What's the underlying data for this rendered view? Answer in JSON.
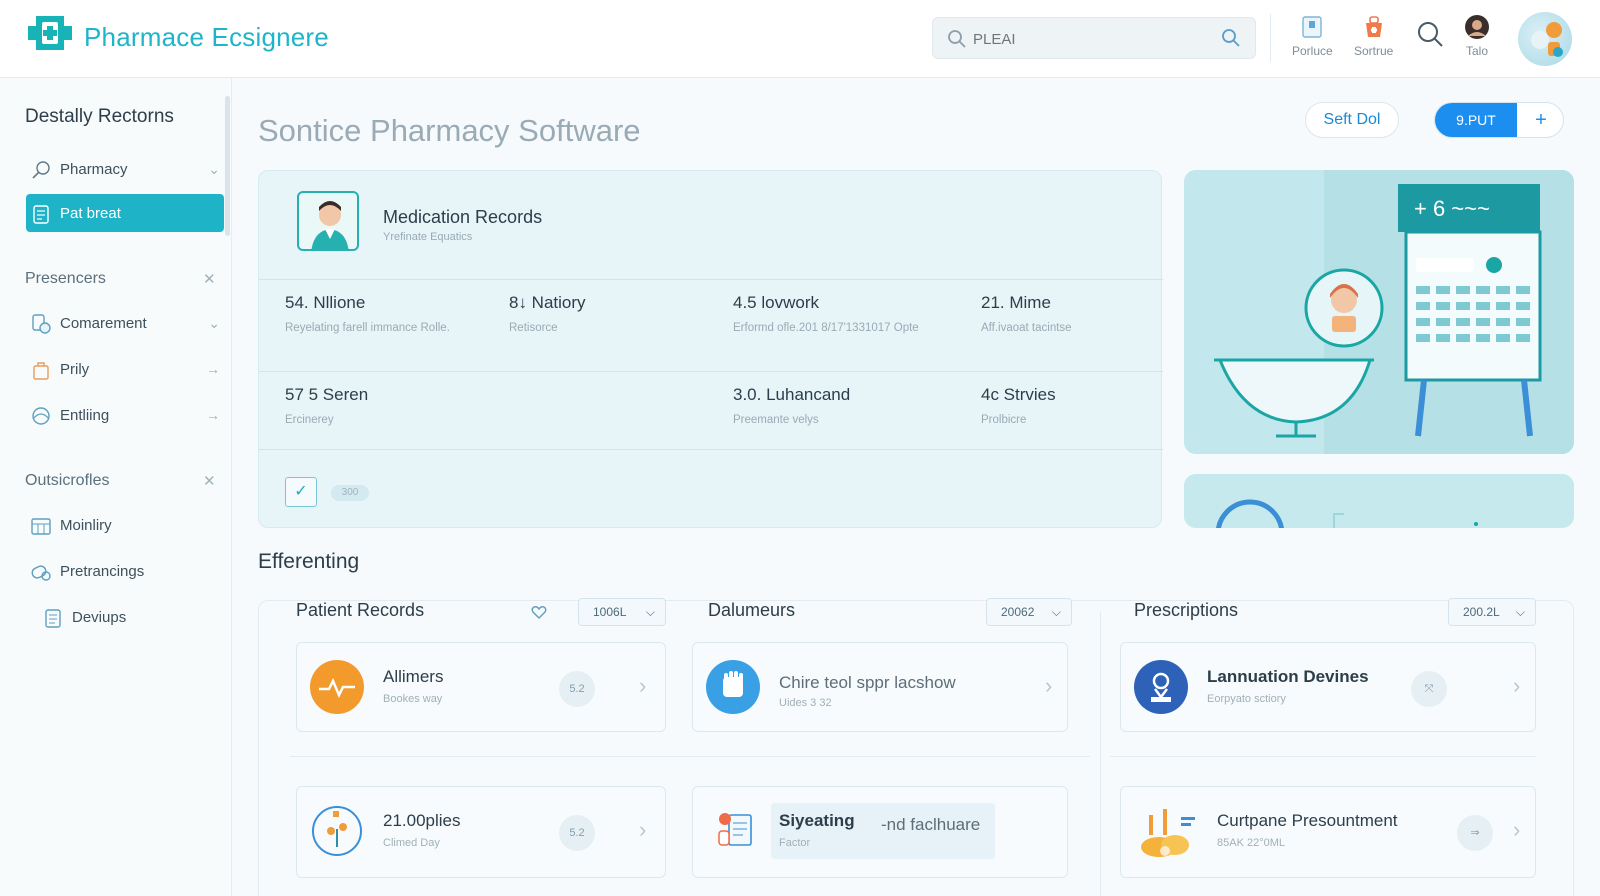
{
  "header": {
    "app_title": "Pharmace Ecsignere",
    "search_placeholder": "PLEAI",
    "buttons": [
      {
        "label": "Porluce",
        "icon": "clipboard-icon"
      },
      {
        "label": "Sortrue",
        "icon": "medicine-bag-icon"
      },
      {
        "label": "",
        "icon": "search-icon"
      },
      {
        "label": "Talo",
        "icon": "user-avatar-icon"
      }
    ]
  },
  "sidebar": {
    "title": "Destally Rectorns",
    "items_top": [
      {
        "label": "Pharmacy",
        "icon": "search-pill-icon"
      },
      {
        "label": "Pat breat",
        "icon": "document-icon",
        "active": true
      }
    ],
    "section1": {
      "heading": "Presencers",
      "items": [
        {
          "label": "Comarement",
          "icon": "pill-shield-icon"
        },
        {
          "label": "Prily",
          "icon": "bag-icon"
        },
        {
          "label": "Entliing",
          "icon": "medical-cross-icon"
        }
      ]
    },
    "section2": {
      "heading": "Outsicrofles",
      "items": [
        {
          "label": "Moinliry",
          "icon": "calendar-grid-icon"
        },
        {
          "label": "Pretrancings",
          "icon": "pills-icon"
        },
        {
          "label": "Deviups",
          "icon": "notes-icon"
        }
      ]
    }
  },
  "main": {
    "page_title": "Sontice Pharmacy Software",
    "self_button": "Seft Dol",
    "split_button_label": "9.PUT",
    "split_button_icon": "+",
    "medication": {
      "title": "Medication Records",
      "subtitle": "Yrefinate Equatics",
      "stats_row1": [
        {
          "value": "54. Nllione",
          "desc": "Reyelating farell immance Rolle."
        },
        {
          "value": "8↓ Natiory",
          "desc": "Retisorce"
        },
        {
          "value": "4.5 lovwork",
          "desc": "Erformd ofle.201 8/17'1331017 Opte"
        },
        {
          "value": "21. Mime",
          "desc": "Aff.ivaoat tacintse"
        }
      ],
      "stats_row2": [
        {
          "value": "57 5 Seren",
          "desc": "Ercinerey"
        },
        {
          "value": "3.0. Luhancand",
          "desc": "Preemante velys"
        },
        {
          "value": "4c Strvies",
          "desc": "Prolbicre"
        }
      ],
      "pill_text": "300"
    },
    "section_title": "Efferenting",
    "columns": [
      {
        "title": "Patient Records",
        "select": "1006L"
      },
      {
        "title": "Dalumeurs",
        "select": "20062"
      },
      {
        "title": "Prescriptions",
        "select": "200.2L"
      }
    ],
    "cards": [
      {
        "title": "Allimers",
        "sub": "Bookes way",
        "badge": "5.2"
      },
      {
        "title": "Chire teol sppr lacshow",
        "sub": "Uides 3 32",
        "badge": ""
      },
      {
        "title": "Lannuation Devines",
        "sub": "Eorpyato sctiory",
        "badge": "⤧"
      },
      {
        "title": "21.00plies",
        "sub": "Climed Day",
        "badge": "5.2"
      },
      {
        "title": "Siyeating",
        "title2": "-nd faclhuare",
        "sub": "Factor",
        "badge": ""
      },
      {
        "title": "Curtpane Presountment",
        "sub": "85AK 22°0ML",
        "badge": "⇒"
      }
    ]
  },
  "colors": {
    "accent": "#1fb3c8",
    "primary_button": "#1b8ef0",
    "card_bg": "#e7f5f9"
  }
}
